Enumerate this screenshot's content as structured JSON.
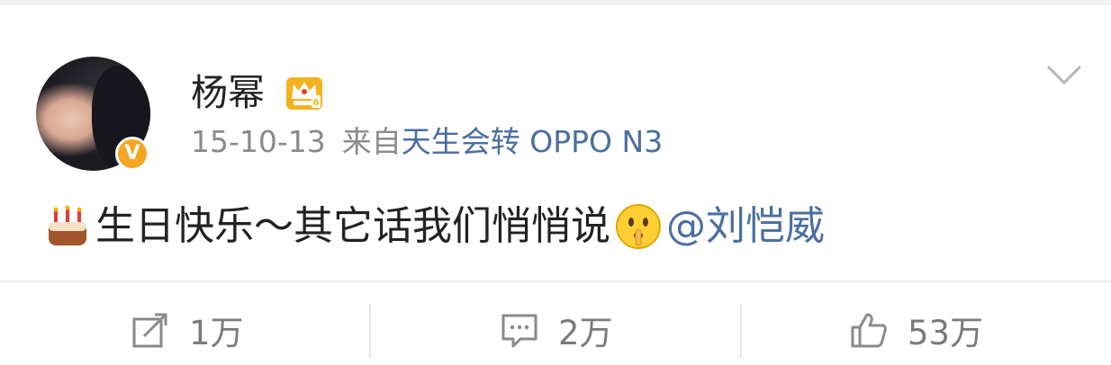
{
  "post": {
    "username": "杨幂",
    "date": "15-10-13",
    "source_prefix": "来自",
    "device": "天生会转 OPPO N3",
    "text": "生日快乐～其它话我们悄悄说",
    "mention": "@刘恺威",
    "verified_badge": "V"
  },
  "actions": {
    "repost_count": "1万",
    "comment_count": "2万",
    "like_count": "53万"
  },
  "icons": {
    "crown": "crown-badge-icon",
    "chevron": "chevron-down-icon",
    "cake": "cake-emoji-icon",
    "shh": "shh-emoji-icon",
    "repost": "repost-icon",
    "comment": "comment-icon",
    "like": "thumbs-up-icon"
  },
  "colors": {
    "link": "#4a6ea0",
    "badge": "#f6a623",
    "crown": "#f5b21f"
  }
}
